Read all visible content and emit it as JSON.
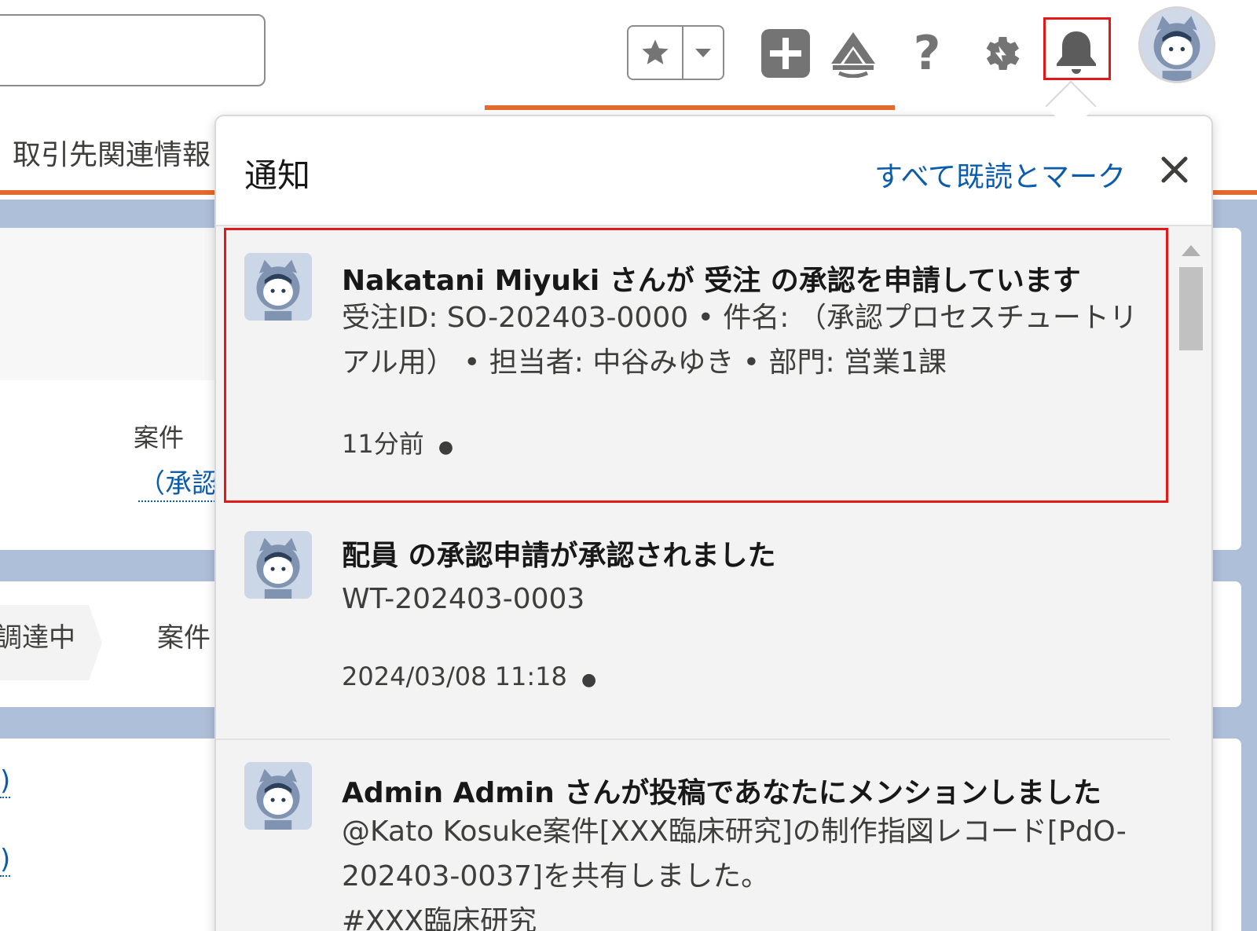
{
  "header": {
    "favorites_icon": "star-icon",
    "favorites_menu_icon": "chevron-down-icon",
    "icons": [
      "add-icon",
      "trailhead-icon",
      "help-icon",
      "gear-icon",
      "bell-icon"
    ],
    "help_glyph": "?"
  },
  "nav": {
    "partial_tab_label": "取引先関連情報"
  },
  "background": {
    "field_label": "案件",
    "field_link": "（承認",
    "path_step_1": "調達中",
    "path_step_2": "案件",
    "link_fragment_1": ")",
    "link_fragment_2": ")"
  },
  "notifications": {
    "title": "通知",
    "mark_all_read": "すべて既読とマーク",
    "close_glyph": "×",
    "items": [
      {
        "title": "Nakatani Miyuki さんが 受注 の承認を申請しています",
        "body": "受注ID: SO-202403-0000 • 件名: （承認プロセスチュートリアル用） • 担当者: 中谷みゆき • 部門: 営業1課",
        "time": "11分前",
        "unread_dot": "●"
      },
      {
        "title": "配員 の承認申請が承認されました",
        "body": "WT-202403-0003",
        "time": "2024/03/08 11:18",
        "unread_dot": "●"
      },
      {
        "title": "Admin Admin さんが投稿であなたにメンションしました",
        "body": "@Kato Kosuke案件[XXX臨床研究]の制作指図レコード[PdO-202403-0037]を共有しました。",
        "body_extra": "#XXX臨床研究"
      }
    ]
  },
  "colors": {
    "accent_orange": "#e56a2e",
    "link_blue": "#0b5cab",
    "highlight_red": "#e31919",
    "page_bg": "#aebfd9"
  }
}
